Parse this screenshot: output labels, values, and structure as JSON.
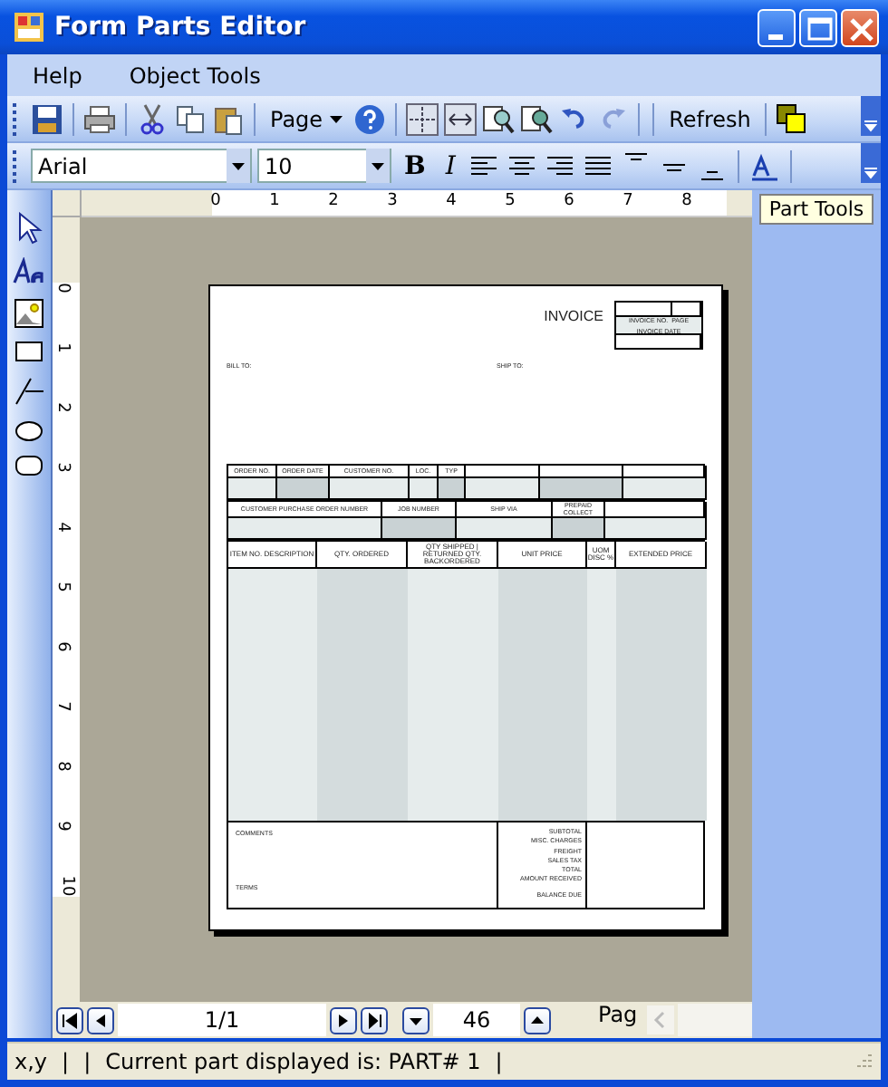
{
  "window": {
    "title": "Form Parts Editor"
  },
  "menu": [
    "Help",
    "Object Tools"
  ],
  "toolbar": {
    "page": "Page",
    "refresh": "Refresh"
  },
  "format_bar": {
    "font": "Arial",
    "size": "10",
    "bold": "B",
    "italic": "I"
  },
  "part_tools_tab": "Part Tools",
  "ruler": {
    "horizontal": [
      "0",
      "1",
      "2",
      "3",
      "4",
      "5",
      "6",
      "7",
      "8"
    ],
    "vertical": [
      "0",
      "1",
      "2",
      "3",
      "4",
      "5",
      "6",
      "7",
      "8",
      "9",
      "10"
    ]
  },
  "invoice": {
    "title": "INVOICE",
    "info_labels": [
      "INVOICE NO.",
      "PAGE",
      "INVOICE DATE"
    ],
    "bill_to": "BILL TO:",
    "ship_to": "SHIP TO:",
    "order_headers": [
      "ORDER NO.",
      "ORDER DATE",
      "CUSTOMER NO.",
      "LOC.",
      "TYP"
    ],
    "po_headers": [
      "CUSTOMER PURCHASE ORDER NUMBER",
      "JOB NUMBER",
      "SHIP VIA",
      "PREPAID COLLECT"
    ],
    "item_columns": [
      "ITEM NO. DESCRIPTION",
      "QTY. ORDERED",
      "QTY SHIPPED | RETURNED QTY. BACKORDERED",
      "UNIT PRICE",
      "UOM DISC %",
      "EXTENDED PRICE"
    ],
    "comments": "COMMENTS",
    "terms": "TERMS",
    "totals": [
      "SUBTOTAL",
      "MISC. CHARGES",
      "FREIGHT",
      "SALES TAX",
      "TOTAL",
      "AMOUNT RECEIVED",
      "BALANCE DUE"
    ]
  },
  "navigator": {
    "page": "1/1",
    "zoom": "46",
    "tab": "Pag"
  },
  "status_bar": [
    "x,y",
    "|",
    "|",
    "Current part displayed is: PART# 1",
    "|"
  ]
}
